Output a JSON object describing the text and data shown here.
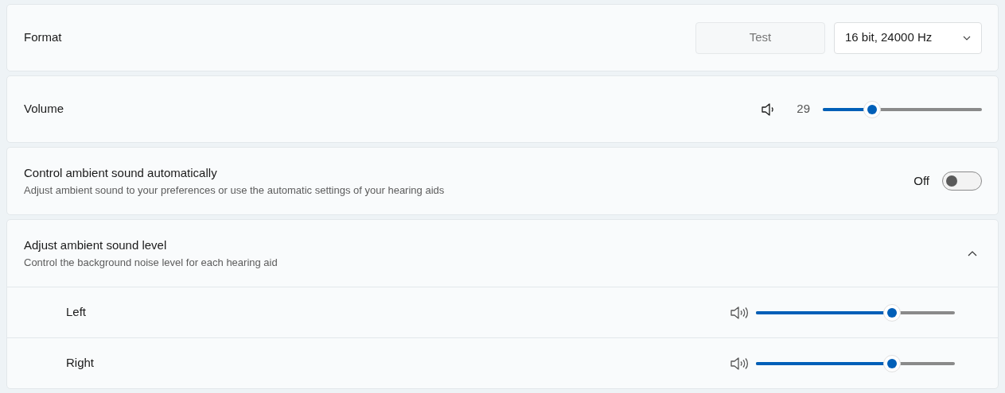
{
  "format": {
    "label": "Format",
    "test_button": "Test",
    "dropdown": {
      "value": "16 bit, 24000 Hz"
    }
  },
  "volume": {
    "label": "Volume",
    "reading": "29",
    "level": 0.31
  },
  "ambient_auto": {
    "title": "Control ambient sound automatically",
    "description": "Adjust ambient sound to your preferences or use the automatic settings of your hearing aids",
    "toggle": {
      "label": "Off",
      "on": false
    }
  },
  "ambient_level": {
    "title": "Adjust ambient sound level",
    "description": "Control the background noise level for each hearing aid",
    "expanded": true,
    "channels": [
      {
        "name": "Left",
        "level": 0.685
      },
      {
        "name": "Right",
        "level": 0.685
      }
    ]
  }
}
